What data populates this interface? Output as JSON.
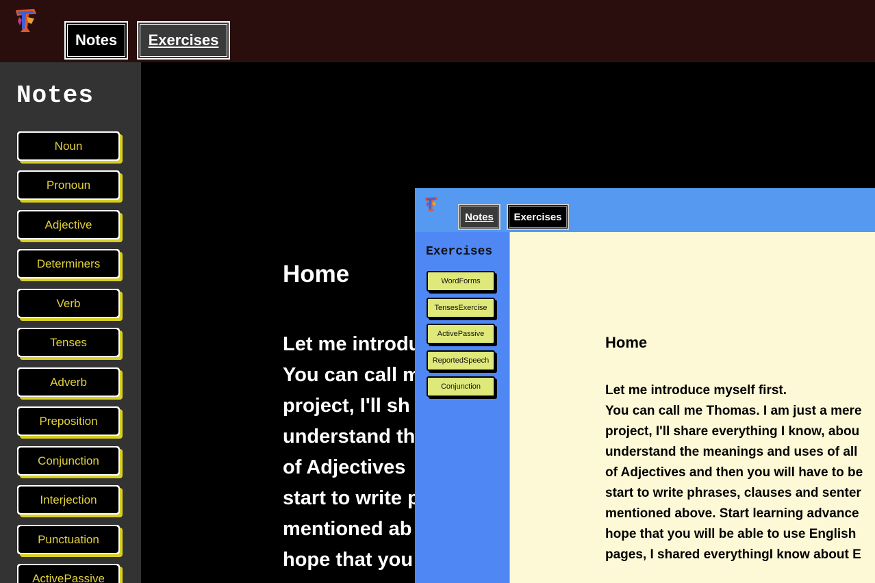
{
  "main": {
    "nav": {
      "notes": "Notes",
      "exercises": "Exercises"
    },
    "sidebar": {
      "title": "Notes",
      "items": [
        {
          "label": "Noun"
        },
        {
          "label": "Pronoun"
        },
        {
          "label": "Adjective"
        },
        {
          "label": "Determiners"
        },
        {
          "label": "Verb"
        },
        {
          "label": "Tenses"
        },
        {
          "label": "Adverb"
        },
        {
          "label": "Preposition"
        },
        {
          "label": "Conjunction"
        },
        {
          "label": "Interjection"
        },
        {
          "label": "Punctuation"
        },
        {
          "label": "ActivePassive"
        }
      ]
    },
    "content": {
      "title": "Home",
      "lines": [
        "Let me introdu",
        "You can call m",
        "project, I'll sh",
        "understand th",
        "of Adjectives",
        "start to write p",
        "mentioned ab",
        "hope that you"
      ]
    }
  },
  "overlay": {
    "nav": {
      "notes": "Notes",
      "exercises": "Exercises"
    },
    "sidebar": {
      "title": "Exercises",
      "items": [
        {
          "label": "WordForms"
        },
        {
          "label": "TensesExercise"
        },
        {
          "label": "ActivePassive"
        },
        {
          "label": "ReportedSpeech"
        },
        {
          "label": "Conjunction"
        }
      ]
    },
    "content": {
      "title": "Home",
      "lines": [
        "Let me introduce myself first.",
        "You can call me Thomas. I am just a mere",
        "project, I'll share everything I know, abou",
        "understand the meanings and uses of all",
        "of Adjectives and then you will have to be",
        "start to write phrases, clauses and senter",
        "mentioned above. Start learning advance",
        "hope that you will be able to use English",
        "pages, I shared everythingI know about E"
      ]
    }
  },
  "colors": {
    "topbar": "#2a0e0e",
    "sidebar": "#333333",
    "sidebar_item_text": "#e2d23a",
    "overlay_topbar": "#5599f0",
    "overlay_sidebar": "#4f88f5",
    "overlay_item": "#dfe97a",
    "overlay_content": "#fdf8d6"
  }
}
